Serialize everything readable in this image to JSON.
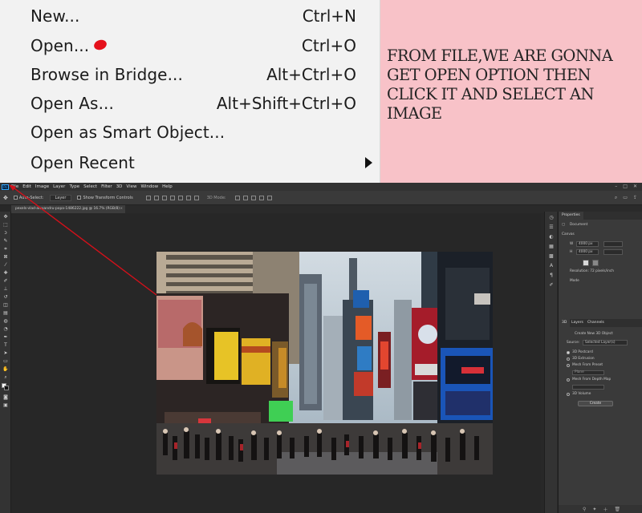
{
  "file_menu": {
    "items": [
      {
        "label": "New...",
        "shortcut": "Ctrl+N"
      },
      {
        "label": "Open...",
        "shortcut": "Ctrl+O"
      },
      {
        "label": "Browse in Bridge...",
        "shortcut": "Alt+Ctrl+O"
      },
      {
        "label": "Open As...",
        "shortcut": "Alt+Shift+Ctrl+O"
      },
      {
        "label": "Open as Smart Object...",
        "shortcut": ""
      },
      {
        "label": "Open Recent",
        "shortcut": ""
      }
    ]
  },
  "note": {
    "text": "From file,we are gonna get open option then click it and select an image"
  },
  "photoshop": {
    "logo": "Ps",
    "menu": [
      "File",
      "Edit",
      "Image",
      "Layer",
      "Type",
      "Select",
      "Filter",
      "3D",
      "View",
      "Window",
      "Help"
    ],
    "window_controls": [
      "–",
      "□",
      "✕"
    ],
    "options": {
      "auto_select": "Auto-Select:",
      "layer_dropdown": "Layer",
      "transform_controls": "Show Transform Controls",
      "mode_3d": "3D Mode:"
    },
    "document_tab": "pexels-vlad-alexandru-popa-1486222.jpg @ 16.7% (RGB/8)",
    "document_tab_close": "×",
    "properties": {
      "tab": "Properties",
      "section_document": "Document",
      "section_canvas": "Canvas",
      "width_label": "W",
      "width_value": "4000 px",
      "height_label": "H",
      "height_value": "4000 px",
      "resolution": "Resolution: 72 pixels/inch",
      "mode_label": "Mode"
    },
    "panel_3d": {
      "tabs": [
        "3D",
        "Layers",
        "Channels"
      ],
      "create_new_label": "Create New 3D Object",
      "source_label": "Source:",
      "source_value": "Selected Layer(s)",
      "options": [
        "3D Postcard",
        "3D Extrusion",
        "Mesh From Preset",
        "Mesh From Depth Map",
        "3D Volume"
      ],
      "selected_option": "3D Postcard",
      "preset_value": "Plane",
      "create_button": "Create"
    },
    "colors": {
      "app_bg": "#282828",
      "panel_bg": "#3a3a3a",
      "accent": "#31a8ff",
      "annotation_red": "#d4101a"
    },
    "tool_icons": [
      "move-icon",
      "marquee-icon",
      "lasso-icon",
      "quick-select-icon",
      "crop-icon",
      "frame-icon",
      "eyedropper-icon",
      "healing-icon",
      "brush-icon",
      "clone-stamp-icon",
      "history-brush-icon",
      "eraser-icon",
      "gradient-icon",
      "blur-icon",
      "dodge-icon",
      "pen-icon",
      "type-icon",
      "path-select-icon",
      "rectangle-icon",
      "hand-icon",
      "zoom-icon",
      "edit-toolbar-icon"
    ]
  }
}
